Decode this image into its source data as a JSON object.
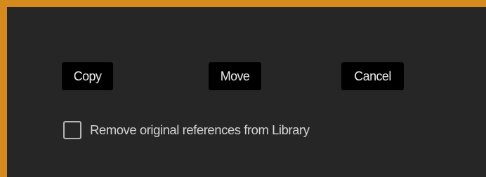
{
  "dialog": {
    "frame_color": "#d68a1e",
    "background_color": "#262626"
  },
  "buttons": {
    "copy_label": "Copy",
    "move_label": "Move",
    "cancel_label": "Cancel"
  },
  "options": {
    "remove_references": {
      "label": "Remove original references from Library",
      "checked": false
    }
  }
}
